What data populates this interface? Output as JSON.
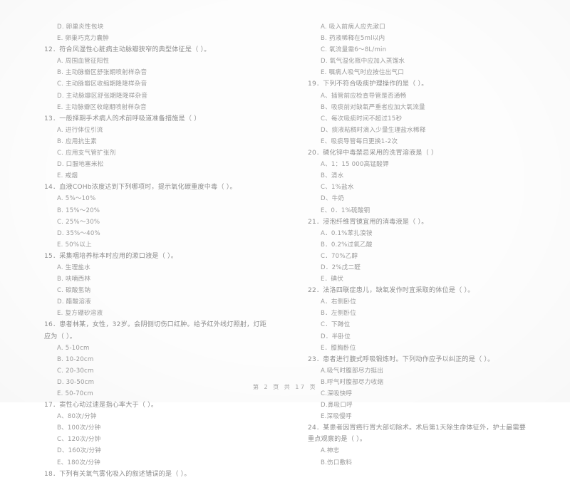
{
  "document": {
    "type": "exam-paper",
    "language": "zh-CN",
    "footer": "第 2 页 共 17 页"
  },
  "left_column": {
    "carryover_options": [
      "D. 卵巢炎性包块",
      "E. 卵巢巧克力囊肿"
    ],
    "questions": [
      {
        "number": "12",
        "stem": "12．符合风湿性心脏病主动脉瓣狭窄的典型体征是（     ）。",
        "options": [
          "A. 周围血管征阳性",
          "B. 主动脉瓣区舒张期喷射样杂音",
          "C. 主动脉瓣区收缩期隆隆样杂音",
          "D. 主动脉瓣区舒张期隆隆样杂音",
          "E. 主动脉瓣区收缩期喷射样杂音"
        ]
      },
      {
        "number": "13",
        "stem": "13．一般择期手术病人的术前呼吸道准备措施是（     ）",
        "options": [
          "A. 进行体位引流",
          "B. 应用抗生素",
          "C. 应用支气管扩张剂",
          "D. 口服地塞米松",
          "E. 戒烟"
        ]
      },
      {
        "number": "14",
        "stem": "14．血液COHb浓度达到下列哪项时，提示氧化碳重度中毒（     ）。",
        "options": [
          "A. 5%～10%",
          "B. 15%～20%",
          "C. 25%～30%",
          "D. 35%～40%",
          "E. 50%以上"
        ]
      },
      {
        "number": "15",
        "stem": "15．采集咽培养标本时应用的漱口液是（     ）。",
        "options": [
          "A. 生理盐水",
          "B. 呋喃西林",
          "C. 碳酸氢钠",
          "D. 醋酸溶液",
          "E. 复方硼砂溶液"
        ]
      },
      {
        "number": "16",
        "stem": "16．患者林某，女性，32岁。会阴侧切伤口红肿。给予红外线灯照射，灯距应为（     ）。",
        "options": [
          "A.  5-10cm",
          "B.  10-20cm",
          "C.  20-30cm",
          "D.  30-50cm",
          "E.  50-70cm"
        ]
      },
      {
        "number": "17",
        "stem": "17．窦性心动过速是指心率大于（     ）。",
        "options": [
          "A、80次/分钟",
          "B、100次/分钟",
          "C、120次/分钟",
          "D、160次/分钟",
          "E、180次/分钟"
        ]
      },
      {
        "number": "18",
        "stem": "18．下列有关氧气雾化吸入的叙述错误的是（     ）。",
        "options": []
      }
    ]
  },
  "right_column": {
    "carryover_options": [
      "A. 吸入前病人应先漱口",
      "B. 药液稀释在5ml以内",
      "C. 氧流量需6～8L/min",
      "D. 氧气湿化瓶中应加入蒸馏水",
      "E. 嘱病人吸气时应按住出气口"
    ],
    "questions": [
      {
        "number": "19",
        "stem": "19．下列不符合吸痰护理操作的是（     ）。",
        "options": [
          "A、插管前应检查导管是否通畅",
          "B、吸痰前对缺氧严重者应加大氧流量",
          "C、每次吸痰时间不超过15秒",
          "D、痰液粘稠时滴入少量生理盐水稀释",
          "E、吸痰导管每日更换1-2次"
        ]
      },
      {
        "number": "20",
        "stem": "20．磷化锌中毒禁忌采用的洗胃溶液是（     ）",
        "options": [
          "A、1：15 000高锰酸钾",
          "B、清水",
          "C、1%盐水",
          "D、牛奶",
          "E、0．1%硫酸铜"
        ]
      },
      {
        "number": "21",
        "stem": "21．浸泡纤维胃镜宜用的消毒液是（     ）。",
        "options": [
          "A．0.1%苯扎溴铵",
          "B．0.2%过氧乙酸",
          "C．70%乙醇",
          "D．2%戊二醛",
          "E．碘伏"
        ]
      },
      {
        "number": "22",
        "stem": "22．法洛四联症患儿，缺氧发作时宜采取的体位是（     ）。",
        "options": [
          "A．右侧卧位",
          "B．左侧卧位",
          "C．下蹲位",
          "D．半卧位",
          "E．膝胸卧位"
        ]
      },
      {
        "number": "23",
        "stem": "23．患者进行腹式呼吸锻炼时。下列动作应予以纠正的是（     ）。",
        "options": [
          "A.吸气时腹部尽力挺出",
          "B.呼气时腹部尽力收缩",
          "C.深吸快呼",
          "D.鼻吸口呼",
          "E.深吸慢呼"
        ]
      },
      {
        "number": "24",
        "stem": "24．某患者因胃癌行胃大部切除术。术后第1天除生命体征外，护士最需要重点观察的是（     ）。",
        "options": [
          "A.神志",
          "B.伤口敷料"
        ]
      }
    ]
  }
}
